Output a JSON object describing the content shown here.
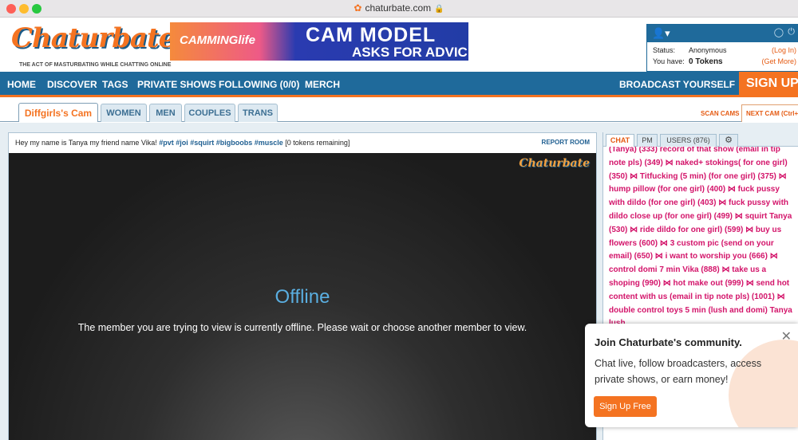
{
  "browser": {
    "url": "chaturbate.com",
    "favicon": "chaturbate-favicon",
    "lock": "lock-icon"
  },
  "header": {
    "logo": "Chaturbate",
    "tagline": "THE ACT OF MASTURBATING WHILE CHATTING ONLINE",
    "banner": {
      "brand": "CAMMINGlife",
      "headline": "CAM MODEL",
      "subline": "ASKS FOR ADVICE"
    },
    "user": {
      "status_label": "Status:",
      "status_value": "Anonymous",
      "status_link": "(Log In)",
      "tokens_label": "You have:",
      "tokens_value": "0 Tokens",
      "tokens_link": "(Get More)"
    }
  },
  "nav": {
    "items": [
      "HOME",
      "DISCOVER",
      "TAGS",
      "PRIVATE SHOWS",
      "FOLLOWING (0/0)",
      "MERCH"
    ],
    "broadcast": "BROADCAST YOURSELF",
    "signup": "SIGN UP"
  },
  "tabs": {
    "items": [
      "Diffgirls's Cam",
      "WOMEN",
      "MEN",
      "COUPLES",
      "TRANS"
    ],
    "scan": "SCAN CAMS",
    "next": "NEXT CAM (Ctrl+/)"
  },
  "room": {
    "subject_text": "Hey my name is Tanya my friend name Vika! ",
    "subject_tags": "#pvt #joi #squirt #bigboobs #muscle",
    "subject_tail": " [0 tokens remaining]",
    "report": "REPORT ROOM",
    "watermark": "Chaturbate",
    "offline_title": "Offline",
    "offline_message": "The member you are trying to view is currently offline. Please wait or choose another member to view."
  },
  "chat": {
    "tabs": [
      "CHAT",
      "PM",
      "USERS (876)"
    ],
    "message": "(Tanya) (333) record of that show (email in tip note pls) (349) ⋈ naked+ stokings( for one girl) (350) ⋈ Titfucking (5 min) (for one girl) (375) ⋈ hump pillow (for one girl) (400) ⋈ fuck pussy with dildo (for one girl) (403) ⋈ fuck pussy with dildo close up (for one girl) (499) ⋈ squirt Tanya (530) ⋈ ride dildo for one girl) (599) ⋈ buy us flowers (600) ⋈ 3 custom pic (send on your email) (650) ⋈ i want to worship you (666) ⋈ control domi 7 min Vika (888) ⋈ take us a shoping (990) ⋈ hot make out (999) ⋈ send hot content with us (email in tip note pls) (1001) ⋈ double control toys 5 min (lush and domi) Tanya lush"
  },
  "popup": {
    "title": "Join Chaturbate's community.",
    "body": "Chat live, follow broadcasters, access private shows, or earn money!",
    "button": "Sign Up Free"
  }
}
